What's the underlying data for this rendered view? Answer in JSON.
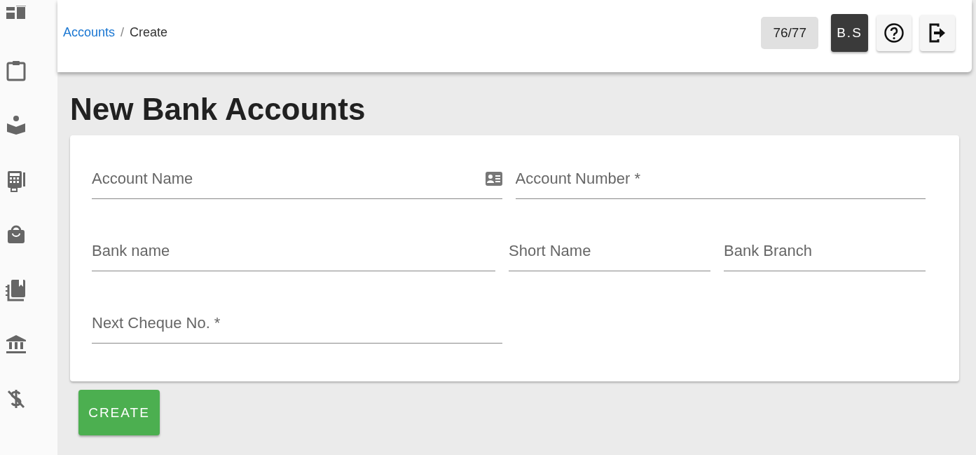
{
  "breadcrumb": {
    "link": "Accounts",
    "separator": "/",
    "current": "Create"
  },
  "header": {
    "counter": "76/77",
    "user_initials": "B.S"
  },
  "page_title": "New Bank Accounts",
  "form": {
    "rows": [
      [
        {
          "placeholder": "Account Name"
        },
        {
          "placeholder": "Account Number *"
        }
      ],
      [
        {
          "placeholder": "Bank name"
        },
        {
          "placeholder": "Short Name"
        },
        {
          "placeholder": "Bank Branch"
        }
      ],
      [
        {
          "placeholder": "Next Cheque No. *"
        }
      ]
    ]
  },
  "buttons": [
    {
      "label": "CREATE"
    }
  ]
}
